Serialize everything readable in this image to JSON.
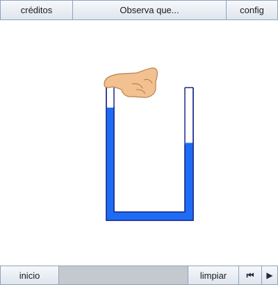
{
  "top_bar": {
    "credits_label": "créditos",
    "title": "Observa que...",
    "config_label": "config"
  },
  "bottom_bar": {
    "start_label": "inicio",
    "clear_label": "limpiar",
    "rewind_glyph": "⏮",
    "play_glyph": "▶"
  },
  "scene": {
    "left_tube_water_level": 0.83,
    "right_tube_water_level": 0.55,
    "water_color": "#1e6cf5",
    "outline_color": "#1a2a88",
    "hand_color": "#f3c090"
  },
  "icons": {
    "rewind": "rewind-icon",
    "play": "play-icon",
    "finger": "hand-finger-icon"
  }
}
